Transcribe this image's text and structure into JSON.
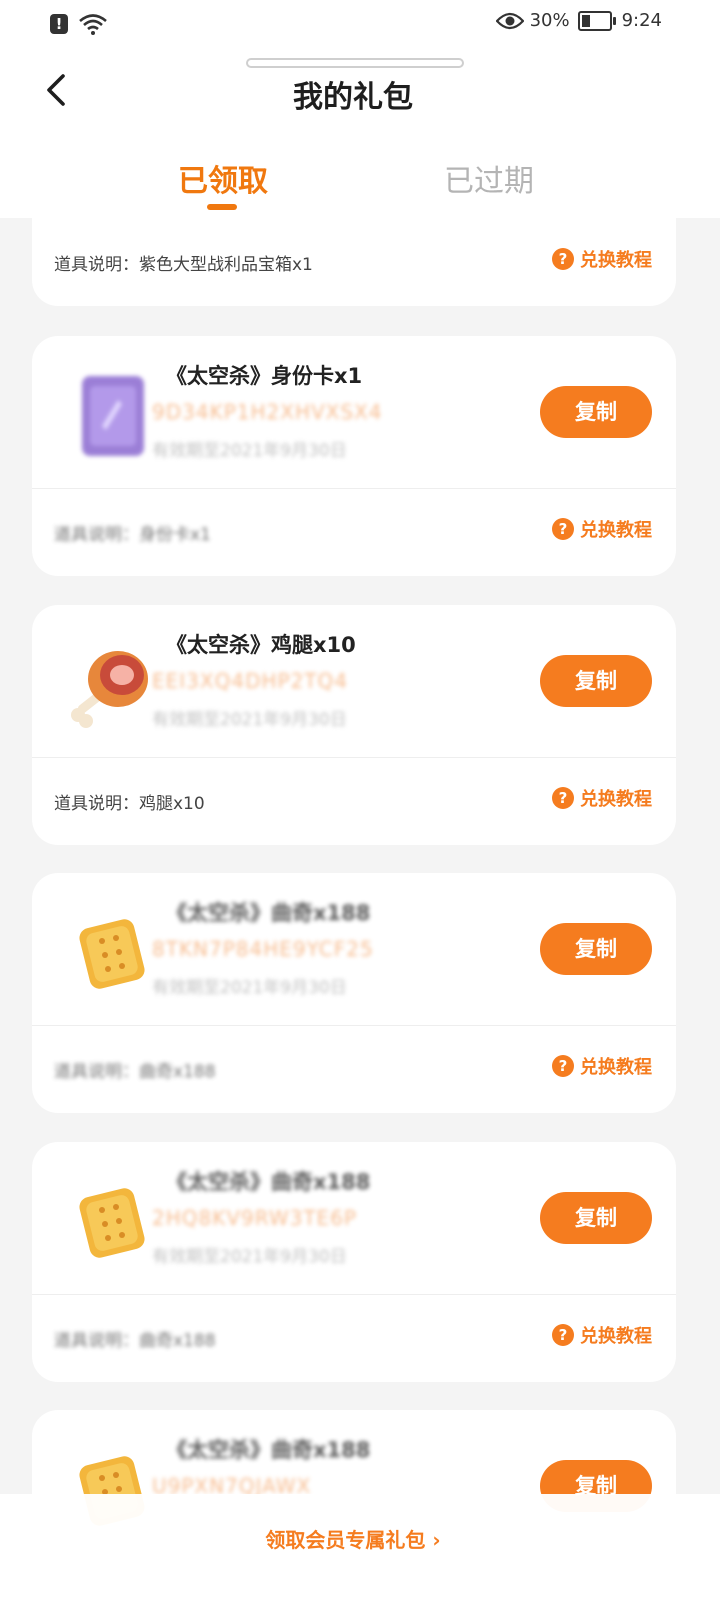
{
  "status_bar": {
    "alert_glyph": "!",
    "battery": "30%",
    "time": "9:24",
    "icons": [
      "alert-icon",
      "wifi-icon",
      "eye-icon",
      "battery-icon"
    ]
  },
  "header": {
    "title": "我的礼包",
    "back_icon": "chevron-left-icon",
    "tabs": [
      {
        "label": "已领取",
        "active": true
      },
      {
        "label": "已过期",
        "active": false
      }
    ]
  },
  "cards": [
    {
      "desc": "道具说明：紫色大型战利品宝箱x1",
      "tutorial": "兑换教程"
    },
    {
      "thumb_icon": "purple-card-icon",
      "title": "《太空杀》身份卡x1",
      "code": "9D34KP1H2XHVXSX4",
      "expire": "有效期至2021年9月30日",
      "copy": "复制",
      "desc": "道具说明：身份卡x1",
      "tutorial": "兑换教程"
    },
    {
      "thumb_icon": "chicken-leg-icon",
      "title": "《太空杀》鸡腿x10",
      "code": "EEI3XQ4DHP2TQ4",
      "expire": "有效期至2021年9月30日",
      "copy": "复制",
      "desc": "道具说明：鸡腿x10",
      "tutorial": "兑换教程"
    },
    {
      "thumb_icon": "biscuit-icon",
      "title": "《太空杀》曲奇x188",
      "code": "8TKN7P84HE9YCF25",
      "expire": "有效期至2021年9月30日",
      "copy": "复制",
      "desc": "道具说明：曲奇x188",
      "tutorial": "兑换教程"
    },
    {
      "thumb_icon": "biscuit-icon",
      "title": "《太空杀》曲奇x188",
      "code": "2HQ8KV9RW3TE6P",
      "expire": "有效期至2021年9月30日",
      "copy": "复制",
      "desc": "道具说明：曲奇x188",
      "tutorial": "兑换教程"
    },
    {
      "thumb_icon": "biscuit-icon",
      "title": "《太空杀》曲奇x188",
      "code": "U9PXN7QJAWX",
      "copy": "复制"
    }
  ],
  "bottom_banner": {
    "label": "领取会员专属礼包 ›"
  },
  "colors": {
    "accent": "#f57c1f",
    "tab_active": "#f0780f",
    "tab_inactive": "#b4b4b4",
    "page_bg": "#f4f4f4",
    "card_bg": "#ffffff"
  }
}
